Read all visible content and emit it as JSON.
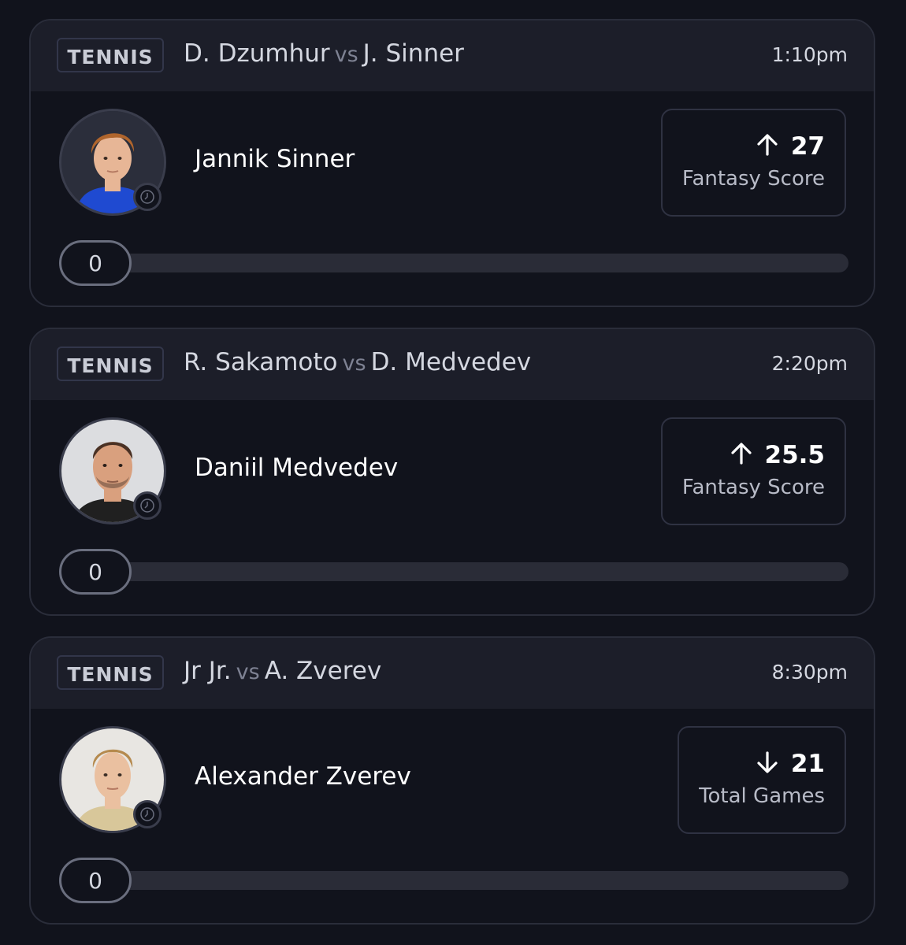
{
  "cards": [
    {
      "sport": "TENNIS",
      "player_a": "D. Dzumhur",
      "vs": "vs",
      "player_b": "J. Sinner",
      "time": "1:10pm",
      "player_name": "Jannik Sinner",
      "direction": "up",
      "direction_icon": "arrow-up-icon",
      "line_value": "27",
      "stat_label": "Fantasy Score",
      "progress_value": "0",
      "progress_fraction": 0,
      "avatar_colors": {
        "hair": "#b0652c",
        "skin": "#e7b696",
        "shirt": "#1f4ad1"
      }
    },
    {
      "sport": "TENNIS",
      "player_a": "R. Sakamoto",
      "vs": "vs",
      "player_b": "D. Medvedev",
      "time": "2:20pm",
      "player_name": "Daniil Medvedev",
      "direction": "up",
      "direction_icon": "arrow-up-icon",
      "line_value": "25.5",
      "stat_label": "Fantasy Score",
      "progress_value": "0",
      "progress_fraction": 0,
      "avatar_colors": {
        "hair": "#4a3124",
        "skin": "#d9a07e",
        "shirt": "#202020"
      }
    },
    {
      "sport": "TENNIS",
      "player_a": "Jr Jr.",
      "vs": "vs",
      "player_b": "A. Zverev",
      "time": "8:30pm",
      "player_name": "Alexander Zverev",
      "direction": "down",
      "direction_icon": "arrow-down-icon",
      "line_value": "21",
      "stat_label": "Total Games",
      "progress_value": "0",
      "progress_fraction": 0,
      "avatar_colors": {
        "hair": "#b58a4e",
        "skin": "#eac0a0",
        "shirt": "#d8c79a"
      }
    }
  ],
  "colors": {
    "background": "#11131c",
    "card_header": "#1c1e29",
    "card_border": "#2a2d3a",
    "text_primary": "#ffffff",
    "text_secondary": "#b8bbc7"
  }
}
